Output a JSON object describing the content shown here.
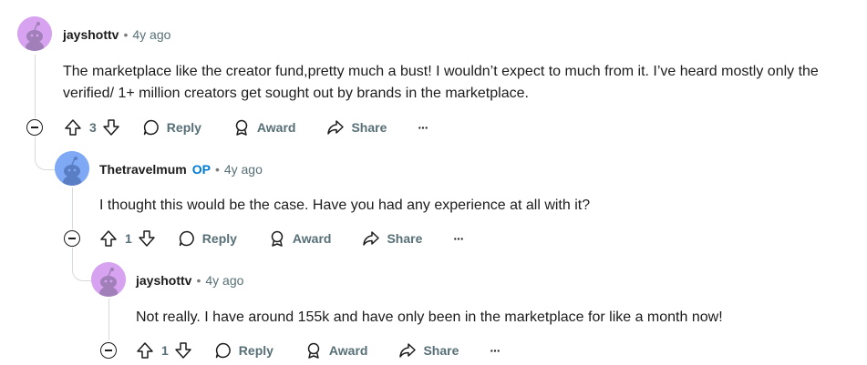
{
  "comments": [
    {
      "author": "jayshottv",
      "op_badge": "",
      "separator": "•",
      "time": "4y ago",
      "body": "The marketplace like the creator fund,pretty much a bust! I wouldn’t expect to much from it. I’ve heard mostly only the verified/ 1+ million creators get sought out by brands in the marketplace.",
      "votes": "3",
      "reply_label": "Reply",
      "award_label": "Award",
      "share_label": "Share",
      "more_label": "···",
      "avatar_color": "#d7a3f0"
    },
    {
      "author": "Thetravelmum",
      "op_badge": "OP",
      "separator": "•",
      "time": "4y ago",
      "body": "I thought this would be the case. Have you had any experience at all with it?",
      "votes": "1",
      "reply_label": "Reply",
      "award_label": "Award",
      "share_label": "Share",
      "more_label": "···",
      "avatar_color": "#7fa8f5"
    },
    {
      "author": "jayshottv",
      "op_badge": "",
      "separator": "•",
      "time": "4y ago",
      "body": "Not really. I have around 155k and have only been in the marketplace for like a month now!",
      "votes": "1",
      "reply_label": "Reply",
      "award_label": "Award",
      "share_label": "Share",
      "more_label": "···",
      "avatar_color": "#d7a3f0"
    }
  ],
  "colors": {
    "op": "#0079d3",
    "muted": "#576f76",
    "thread": "#d7dadc"
  },
  "icons": [
    "snoo-avatar-icon",
    "upvote-icon",
    "downvote-icon",
    "comment-bubble-icon",
    "award-icon",
    "share-arrow-icon",
    "more-icon",
    "collapse-icon"
  ]
}
